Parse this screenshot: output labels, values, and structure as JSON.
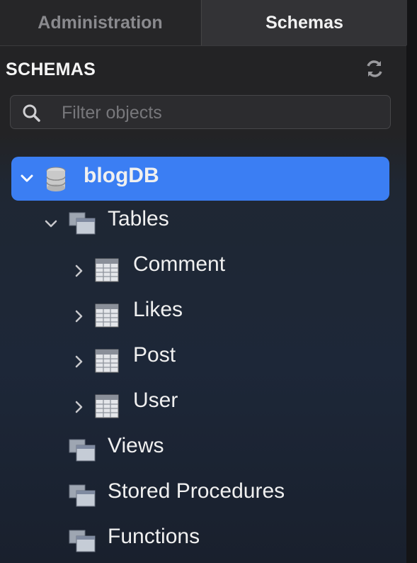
{
  "tabs": [
    {
      "label": "Administration",
      "active": false
    },
    {
      "label": "Schemas",
      "active": true
    }
  ],
  "schemas_header": {
    "title": "SCHEMAS",
    "refresh_icon": "refresh-icon"
  },
  "filter": {
    "placeholder": "Filter objects",
    "value": ""
  },
  "tree": {
    "database": {
      "label": "blogDB",
      "expanded": true,
      "selected": true
    },
    "tables": {
      "label": "Tables",
      "expanded": true
    },
    "table_items": [
      {
        "label": "Comment"
      },
      {
        "label": "Likes"
      },
      {
        "label": "Post"
      },
      {
        "label": "User"
      }
    ],
    "views": {
      "label": "Views"
    },
    "procedures": {
      "label": "Stored Procedures"
    },
    "functions": {
      "label": "Functions"
    }
  },
  "colors": {
    "selection": "#3b7ef3",
    "panel_bg": "#232325",
    "text": "#f0f0f0"
  }
}
